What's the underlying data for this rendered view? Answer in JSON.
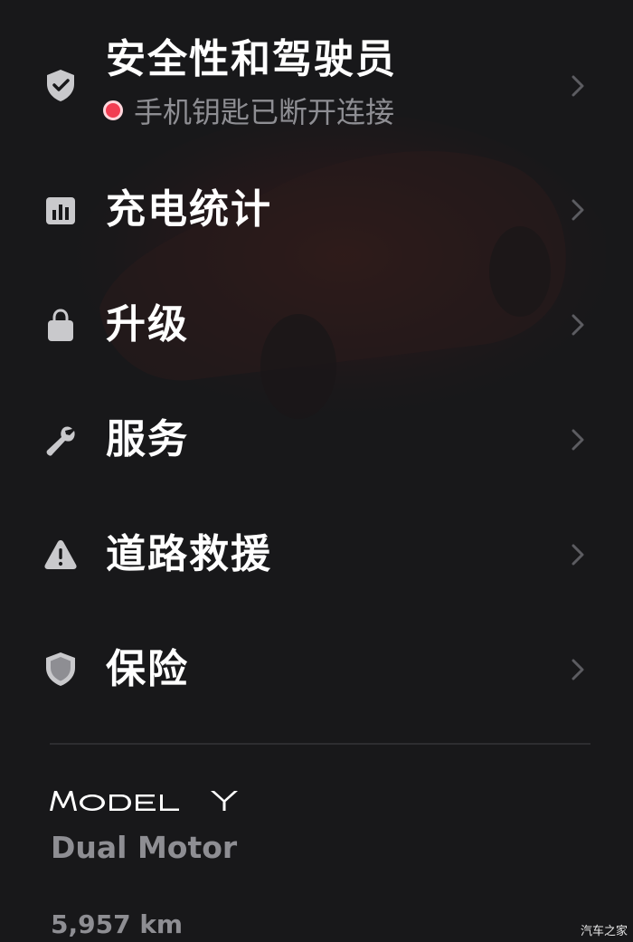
{
  "menu": {
    "items": [
      {
        "label": "安全性和驾驶员",
        "icon": "shield-check-icon",
        "sublabel": "手机钥匙已断开连接",
        "status_color": "#f23d52"
      },
      {
        "label": "充电统计",
        "icon": "bar-chart-icon"
      },
      {
        "label": "升级",
        "icon": "shopping-bag-icon"
      },
      {
        "label": "服务",
        "icon": "wrench-icon"
      },
      {
        "label": "道路救援",
        "icon": "warning-triangle-icon"
      },
      {
        "label": "保险",
        "icon": "shield-icon"
      }
    ]
  },
  "vehicle": {
    "model_logo": "MODEL Y",
    "variant": "Dual Motor",
    "odometer": "5,957 km"
  },
  "watermark": "汽车之家",
  "colors": {
    "background": "#18181a",
    "icon": "#c9c9cc",
    "secondary_text": "#8e8e93",
    "chevron": "#5c5c61",
    "status_disconnected": "#f23d52"
  }
}
